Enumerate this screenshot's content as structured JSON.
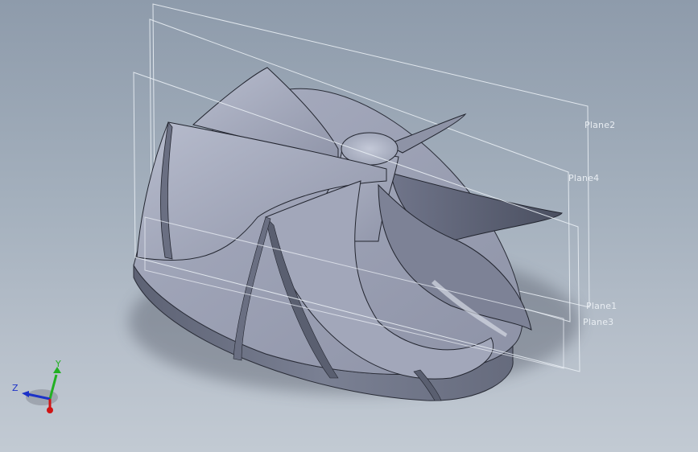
{
  "viewport": {
    "background_top": "#8e9bab",
    "background_bottom": "#c2cad3",
    "model": {
      "name": "impeller",
      "body_color": "#9ea4b8",
      "shadow_color": "#555a6a"
    }
  },
  "planes": {
    "plane1": "Plane1",
    "plane2": "Plane2",
    "plane3": "Plane3",
    "plane4": "Plane4"
  },
  "triad": {
    "x_label": "",
    "y_label": "Y",
    "z_label": "Z",
    "x_color": "#d01414",
    "y_color": "#22b022",
    "z_color": "#1c32c8"
  }
}
